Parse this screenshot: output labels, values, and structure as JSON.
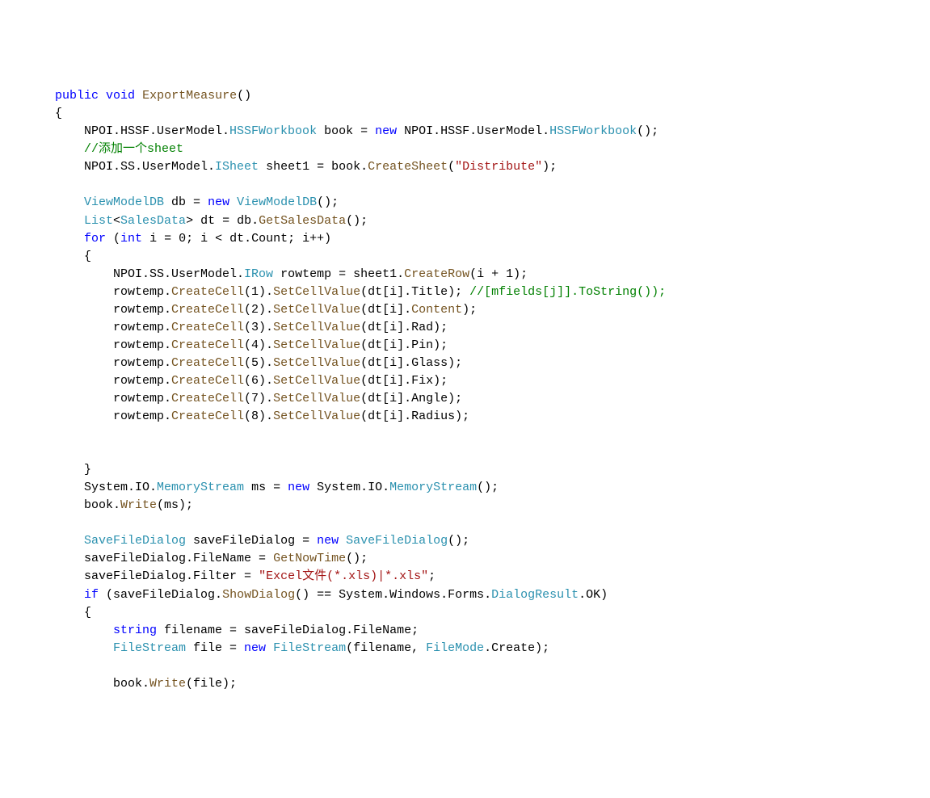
{
  "code": {
    "lines": [
      {
        "indent": 0,
        "tokens": [
          {
            "type": "keyword",
            "text": "public"
          },
          {
            "type": "normal",
            "text": " "
          },
          {
            "type": "keyword",
            "text": "void"
          },
          {
            "type": "normal",
            "text": " "
          },
          {
            "type": "method",
            "text": "ExportMeasure"
          },
          {
            "type": "normal",
            "text": "()"
          }
        ]
      },
      {
        "indent": 0,
        "tokens": [
          {
            "type": "normal",
            "text": "{"
          }
        ]
      },
      {
        "indent": 1,
        "tokens": [
          {
            "type": "normal",
            "text": "NPOI.HSSF.UserModel."
          },
          {
            "type": "type",
            "text": "HSSFWorkbook"
          },
          {
            "type": "normal",
            "text": " book = "
          },
          {
            "type": "keyword",
            "text": "new"
          },
          {
            "type": "normal",
            "text": " NPOI.HSSF.UserModel."
          },
          {
            "type": "type",
            "text": "HSSFWorkbook"
          },
          {
            "type": "normal",
            "text": "();"
          }
        ]
      },
      {
        "indent": 1,
        "tokens": [
          {
            "type": "comment",
            "text": "//添加一个sheet"
          }
        ]
      },
      {
        "indent": 1,
        "tokens": [
          {
            "type": "normal",
            "text": "NPOI.SS.UserModel."
          },
          {
            "type": "type",
            "text": "ISheet"
          },
          {
            "type": "normal",
            "text": " sheet1 = book."
          },
          {
            "type": "method",
            "text": "CreateSheet"
          },
          {
            "type": "normal",
            "text": "("
          },
          {
            "type": "string",
            "text": "\"Distribute\""
          },
          {
            "type": "normal",
            "text": ");"
          }
        ]
      },
      {
        "indent": 0,
        "tokens": []
      },
      {
        "indent": 1,
        "tokens": [
          {
            "type": "type",
            "text": "ViewModelDB"
          },
          {
            "type": "normal",
            "text": " db = "
          },
          {
            "type": "keyword",
            "text": "new"
          },
          {
            "type": "normal",
            "text": " "
          },
          {
            "type": "type",
            "text": "ViewModelDB"
          },
          {
            "type": "normal",
            "text": "();"
          }
        ]
      },
      {
        "indent": 1,
        "tokens": [
          {
            "type": "type",
            "text": "List"
          },
          {
            "type": "normal",
            "text": "<"
          },
          {
            "type": "type",
            "text": "SalesData"
          },
          {
            "type": "normal",
            "text": "> dt = db."
          },
          {
            "type": "method",
            "text": "GetSalesData"
          },
          {
            "type": "normal",
            "text": "();"
          }
        ]
      },
      {
        "indent": 1,
        "tokens": [
          {
            "type": "keyword",
            "text": "for"
          },
          {
            "type": "normal",
            "text": " ("
          },
          {
            "type": "keyword",
            "text": "int"
          },
          {
            "type": "normal",
            "text": " i = 0; i < dt.Count; i++)"
          }
        ]
      },
      {
        "indent": 1,
        "tokens": [
          {
            "type": "normal",
            "text": "{"
          }
        ]
      },
      {
        "indent": 2,
        "tokens": [
          {
            "type": "normal",
            "text": "NPOI.SS.UserModel."
          },
          {
            "type": "type",
            "text": "IRow"
          },
          {
            "type": "normal",
            "text": " rowtemp = sheet1."
          },
          {
            "type": "method",
            "text": "CreateRow"
          },
          {
            "type": "normal",
            "text": "(i + 1);"
          }
        ]
      },
      {
        "indent": 2,
        "tokens": [
          {
            "type": "normal",
            "text": "rowtemp."
          },
          {
            "type": "method",
            "text": "CreateCell"
          },
          {
            "type": "normal",
            "text": "(1)."
          },
          {
            "type": "method",
            "text": "SetCellValue"
          },
          {
            "type": "normal",
            "text": "(dt[i].Title); "
          },
          {
            "type": "comment",
            "text": "//[mfields[j]].ToString());"
          }
        ]
      },
      {
        "indent": 2,
        "tokens": [
          {
            "type": "normal",
            "text": "rowtemp."
          },
          {
            "type": "method",
            "text": "CreateCell"
          },
          {
            "type": "normal",
            "text": "(2)."
          },
          {
            "type": "method",
            "text": "SetCellValue"
          },
          {
            "type": "normal",
            "text": "(dt[i]."
          },
          {
            "type": "method",
            "text": "Content"
          },
          {
            "type": "normal",
            "text": ");"
          }
        ]
      },
      {
        "indent": 2,
        "tokens": [
          {
            "type": "normal",
            "text": "rowtemp."
          },
          {
            "type": "method",
            "text": "CreateCell"
          },
          {
            "type": "normal",
            "text": "(3)."
          },
          {
            "type": "method",
            "text": "SetCellValue"
          },
          {
            "type": "normal",
            "text": "(dt[i].Rad);"
          }
        ]
      },
      {
        "indent": 2,
        "tokens": [
          {
            "type": "normal",
            "text": "rowtemp."
          },
          {
            "type": "method",
            "text": "CreateCell"
          },
          {
            "type": "normal",
            "text": "(4)."
          },
          {
            "type": "method",
            "text": "SetCellValue"
          },
          {
            "type": "normal",
            "text": "(dt[i].Pin);"
          }
        ]
      },
      {
        "indent": 2,
        "tokens": [
          {
            "type": "normal",
            "text": "rowtemp."
          },
          {
            "type": "method",
            "text": "CreateCell"
          },
          {
            "type": "normal",
            "text": "(5)."
          },
          {
            "type": "method",
            "text": "SetCellValue"
          },
          {
            "type": "normal",
            "text": "(dt[i].Glass);"
          }
        ]
      },
      {
        "indent": 2,
        "tokens": [
          {
            "type": "normal",
            "text": "rowtemp."
          },
          {
            "type": "method",
            "text": "CreateCell"
          },
          {
            "type": "normal",
            "text": "(6)."
          },
          {
            "type": "method",
            "text": "SetCellValue"
          },
          {
            "type": "normal",
            "text": "(dt[i].Fix);"
          }
        ]
      },
      {
        "indent": 2,
        "tokens": [
          {
            "type": "normal",
            "text": "rowtemp."
          },
          {
            "type": "method",
            "text": "CreateCell"
          },
          {
            "type": "normal",
            "text": "(7)."
          },
          {
            "type": "method",
            "text": "SetCellValue"
          },
          {
            "type": "normal",
            "text": "(dt[i].Angle);"
          }
        ]
      },
      {
        "indent": 2,
        "tokens": [
          {
            "type": "normal",
            "text": "rowtemp."
          },
          {
            "type": "method",
            "text": "CreateCell"
          },
          {
            "type": "normal",
            "text": "(8)."
          },
          {
            "type": "method",
            "text": "SetCellValue"
          },
          {
            "type": "normal",
            "text": "(dt[i].Radius);"
          }
        ]
      },
      {
        "indent": 0,
        "tokens": []
      },
      {
        "indent": 0,
        "tokens": []
      },
      {
        "indent": 1,
        "tokens": [
          {
            "type": "normal",
            "text": "}"
          }
        ]
      },
      {
        "indent": 1,
        "tokens": [
          {
            "type": "normal",
            "text": "System.IO."
          },
          {
            "type": "type",
            "text": "MemoryStream"
          },
          {
            "type": "normal",
            "text": " ms = "
          },
          {
            "type": "keyword",
            "text": "new"
          },
          {
            "type": "normal",
            "text": " System.IO."
          },
          {
            "type": "type",
            "text": "MemoryStream"
          },
          {
            "type": "normal",
            "text": "();"
          }
        ]
      },
      {
        "indent": 1,
        "tokens": [
          {
            "type": "normal",
            "text": "book."
          },
          {
            "type": "method",
            "text": "Write"
          },
          {
            "type": "normal",
            "text": "(ms);"
          }
        ]
      },
      {
        "indent": 0,
        "tokens": []
      },
      {
        "indent": 1,
        "tokens": [
          {
            "type": "type",
            "text": "SaveFileDialog"
          },
          {
            "type": "normal",
            "text": " saveFileDialog = "
          },
          {
            "type": "keyword",
            "text": "new"
          },
          {
            "type": "normal",
            "text": " "
          },
          {
            "type": "type",
            "text": "SaveFileDialog"
          },
          {
            "type": "normal",
            "text": "();"
          }
        ]
      },
      {
        "indent": 1,
        "tokens": [
          {
            "type": "normal",
            "text": "saveFileDialog.FileName = "
          },
          {
            "type": "method",
            "text": "GetNowTime"
          },
          {
            "type": "normal",
            "text": "();"
          }
        ]
      },
      {
        "indent": 1,
        "tokens": [
          {
            "type": "normal",
            "text": "saveFileDialog.Filter = "
          },
          {
            "type": "string",
            "text": "\"Excel文件(*.xls)|*.xls\""
          },
          {
            "type": "normal",
            "text": ";"
          }
        ]
      },
      {
        "indent": 1,
        "tokens": [
          {
            "type": "keyword",
            "text": "if"
          },
          {
            "type": "normal",
            "text": " (saveFileDialog."
          },
          {
            "type": "method",
            "text": "ShowDialog"
          },
          {
            "type": "normal",
            "text": "() == System.Windows.Forms."
          },
          {
            "type": "type",
            "text": "DialogResult"
          },
          {
            "type": "normal",
            "text": ".OK)"
          }
        ]
      },
      {
        "indent": 1,
        "tokens": [
          {
            "type": "normal",
            "text": "{"
          }
        ]
      },
      {
        "indent": 2,
        "tokens": [
          {
            "type": "keyword",
            "text": "string"
          },
          {
            "type": "normal",
            "text": " filename = saveFileDialog.FileName;"
          }
        ]
      },
      {
        "indent": 2,
        "tokens": [
          {
            "type": "type",
            "text": "FileStream"
          },
          {
            "type": "normal",
            "text": " file = "
          },
          {
            "type": "keyword",
            "text": "new"
          },
          {
            "type": "normal",
            "text": " "
          },
          {
            "type": "type",
            "text": "FileStream"
          },
          {
            "type": "normal",
            "text": "(filename, "
          },
          {
            "type": "type",
            "text": "FileMode"
          },
          {
            "type": "normal",
            "text": ".Create);"
          }
        ]
      },
      {
        "indent": 0,
        "tokens": []
      },
      {
        "indent": 2,
        "tokens": [
          {
            "type": "normal",
            "text": "book."
          },
          {
            "type": "method",
            "text": "Write"
          },
          {
            "type": "normal",
            "text": "(file);"
          }
        ]
      }
    ]
  }
}
